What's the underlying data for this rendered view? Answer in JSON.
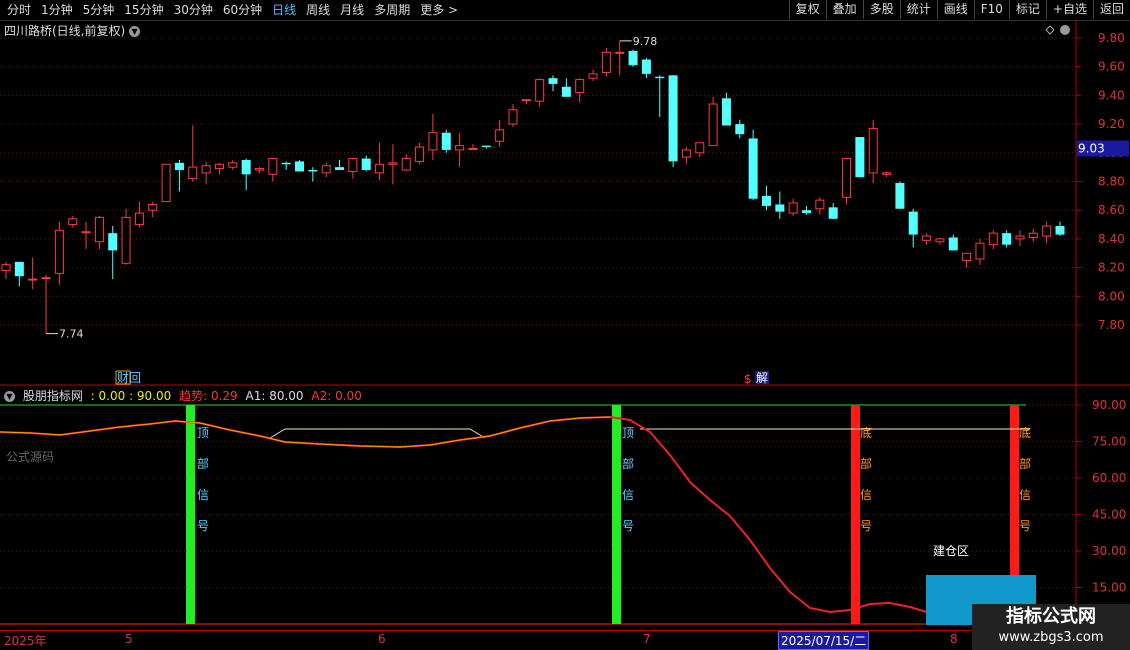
{
  "toolbar": {
    "periods": [
      "分时",
      "1分钟",
      "5分钟",
      "15分钟",
      "30分钟",
      "60分钟",
      "日线",
      "周线",
      "月线",
      "多周期",
      "更多 >"
    ],
    "active_period": "日线",
    "actions": [
      "复权",
      "叠加",
      "多股",
      "统计",
      "画线",
      "F10",
      "标记",
      "+自选",
      "返回"
    ]
  },
  "stock_title": "四川路桥(日线,前复权)",
  "price_axis": [
    "9.80",
    "9.60",
    "9.40",
    "9.20",
    "9.00",
    "8.80",
    "8.60",
    "8.40",
    "8.20",
    "8.00",
    "7.80"
  ],
  "current_price": "9.03",
  "high_label": "9.78",
  "low_label": "7.74",
  "event_labels": {
    "finance": "财回",
    "unlock_symbol": "$",
    "unlock": "解"
  },
  "indicator": {
    "name": "股朋指标网",
    "vals": ": 0.00 : 90.00",
    "trend_label": "趋势: 0.29",
    "a1_label": "A1: 80.00",
    "a2_label": "A2: 0.00",
    "source_label": "公式源码",
    "axis": [
      "90.00",
      "75.00",
      "60.00",
      "45.00",
      "30.00",
      "15.00"
    ],
    "top_signal": [
      "顶",
      "部",
      "信",
      "号"
    ],
    "bottom_signal": [
      "底",
      "部",
      "信",
      "号"
    ],
    "build_zone": "建仓区"
  },
  "date_axis": {
    "year": "2025年",
    "m5": "5",
    "m6": "6",
    "m7": "7",
    "m8": "8",
    "cursor": "2025/07/15/二"
  },
  "watermark": {
    "line1": "指标公式网",
    "line2": "www.zbgs3.com"
  },
  "colors": {
    "up": "#ff3b3b",
    "down": "#54ffff",
    "green": "#22ee22",
    "red": "#ff1a1a",
    "cyan_box": "#1199cc"
  }
}
